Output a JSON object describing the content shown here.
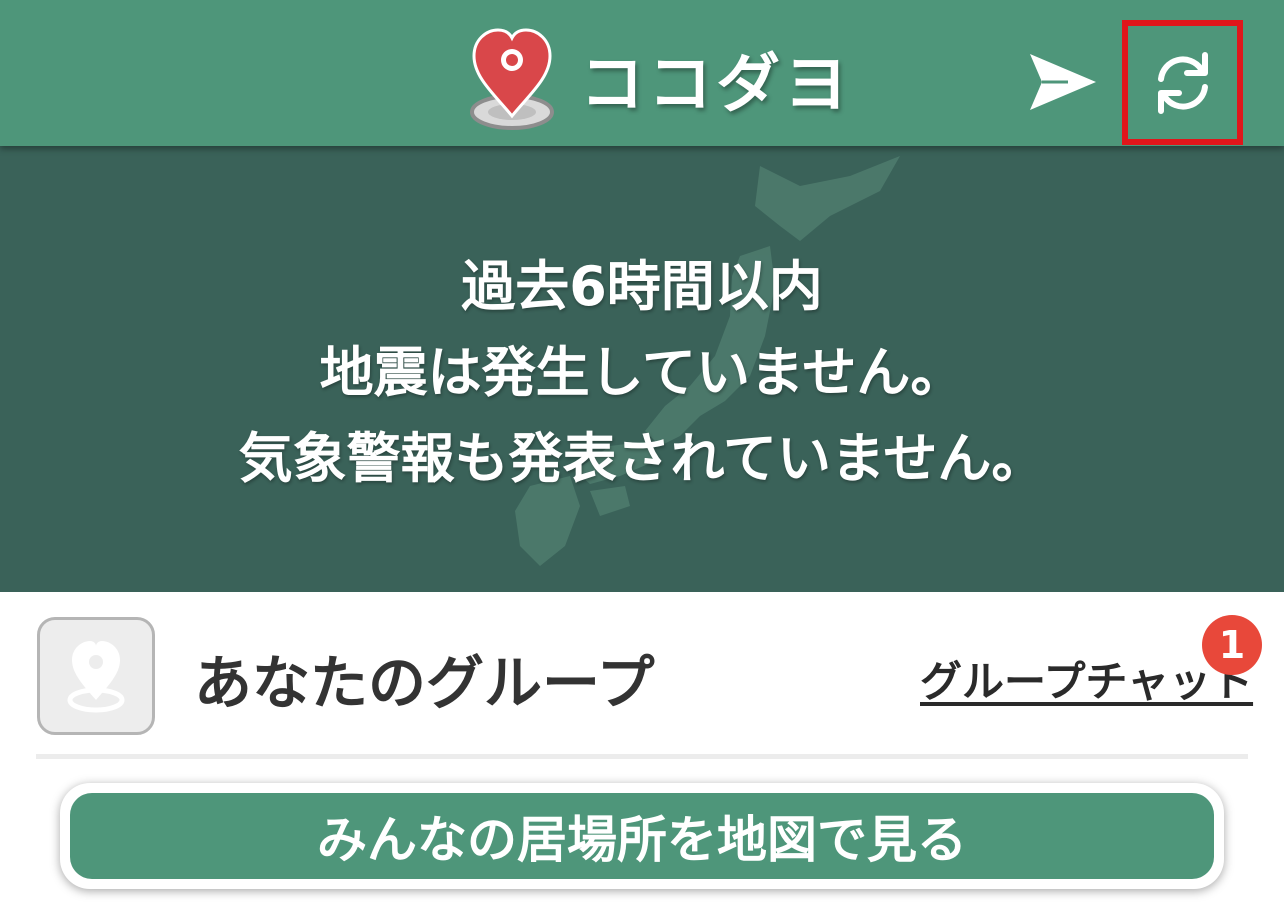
{
  "header": {
    "app_title": "ココダヨ",
    "brand_color": "#4e967a",
    "logo_icon": "map-pin-heart-icon",
    "send_icon": "send-icon",
    "refresh_icon": "refresh-icon",
    "refresh_highlight_color": "#e0161b"
  },
  "banner": {
    "background_icon": "japan-map-icon",
    "lines": [
      "過去6時間以内",
      "地震は発生していません。",
      "気象警報も発表されていません。"
    ]
  },
  "group": {
    "icon": "location-pin-icon",
    "title": "あなたのグループ",
    "chat_link": "グループチャット",
    "badge_count": "1",
    "badge_color": "#e8483a"
  },
  "map_button": {
    "label": "みんなの居場所を地図で見る"
  }
}
